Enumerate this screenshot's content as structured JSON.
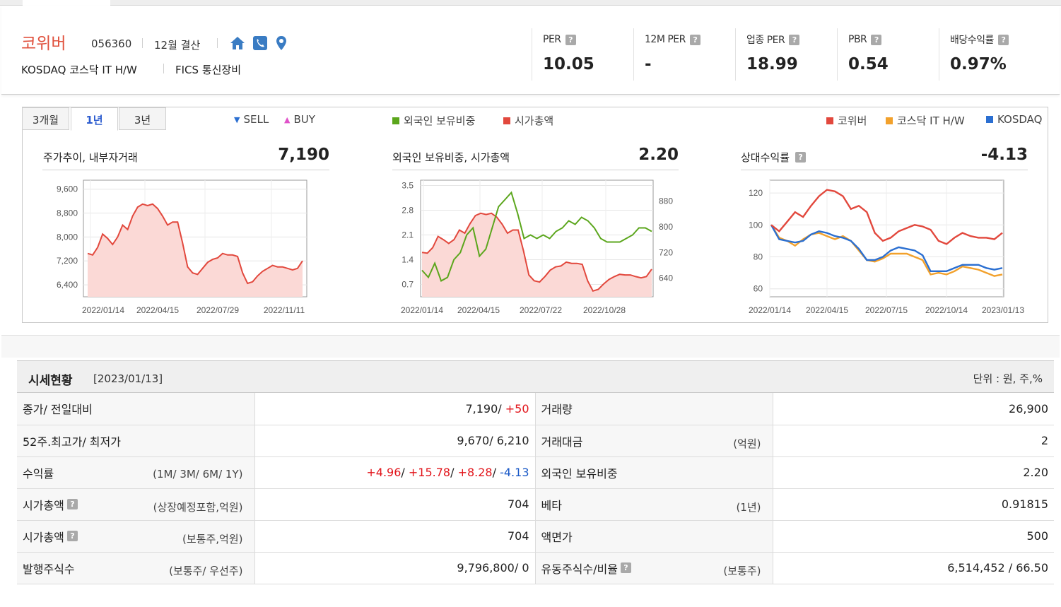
{
  "company": {
    "name": "코위버",
    "code": "056360",
    "settlement": "12월 결산",
    "market": "KOSDAQ  코스닥 IT H/W",
    "fics": "FICS 통신장비",
    "icons": [
      "home-icon",
      "phone-icon",
      "location-pin-icon"
    ]
  },
  "metrics": [
    {
      "label": "PER",
      "value": "10.05"
    },
    {
      "label": "12M PER",
      "value": "-"
    },
    {
      "label": "업종 PER",
      "value": "18.99"
    },
    {
      "label": "PBR",
      "value": "0.54"
    },
    {
      "label": "배당수익률",
      "value": "0.97%"
    }
  ],
  "tabs": [
    {
      "label": "3개월",
      "active": false
    },
    {
      "label": "1년",
      "active": true
    },
    {
      "label": "3년",
      "active": false
    }
  ],
  "legends": {
    "sell": "SELL",
    "buy": "BUY",
    "foreign": "외국인 보유비중",
    "marketcap": "시가총액",
    "company": "코위버",
    "sector": "코스닥 IT H/W",
    "index": "KOSDAQ"
  },
  "colors": {
    "red_line": "#e2483d",
    "red_fill": "#fbd9d6",
    "green_line": "#5ba61c",
    "orange_line": "#f2a12c",
    "blue_line": "#2b6fd1",
    "brand": "#e0513d"
  },
  "panels": {
    "price": {
      "title": "주가추이, 내부자거래",
      "value": "7,190"
    },
    "foreign": {
      "title": "외국인 보유비중, 시가총액",
      "value": "2.20"
    },
    "relative": {
      "title": "상대수익률",
      "value": "-4.13"
    }
  },
  "chart_data": [
    {
      "type": "area",
      "title": "주가추이, 내부자거래",
      "x_labels": [
        "2022/01/14",
        "2022/04/15",
        "2022/07/29",
        "2022/11/11"
      ],
      "y_ticks": [
        "9,600",
        "8,800",
        "8,000",
        "7,200",
        "6,400"
      ],
      "ylim": [
        6000,
        9900
      ],
      "series": [
        {
          "name": "코위버",
          "values": [
            7450,
            7400,
            7650,
            8100,
            7950,
            7750,
            8000,
            8400,
            8250,
            8700,
            9000,
            9100,
            9050,
            9100,
            8950,
            8700,
            8400,
            8500,
            8500,
            7800,
            7000,
            6800,
            6750,
            6950,
            7150,
            7250,
            7300,
            7450,
            7400,
            7400,
            7350,
            6800,
            6450,
            6500,
            6700,
            6850,
            6950,
            7050,
            7000,
            7000,
            6950,
            6900,
            6950,
            7200
          ]
        }
      ]
    },
    {
      "type": "line",
      "title": "외국인 보유비중, 시가총액",
      "x_labels": [
        "2022/01/14",
        "2022/04/15",
        "2022/07/22",
        "2022/10/28"
      ],
      "y_ticks_left": [
        "3.5",
        "2.8",
        "2.1",
        "1.4",
        "0.7"
      ],
      "y_ticks_right": [
        "880",
        "800",
        "720",
        "640"
      ],
      "series": [
        {
          "name": "외국인 보유비중",
          "values": [
            1.1,
            0.9,
            1.3,
            0.8,
            0.9,
            1.4,
            1.6,
            2.1,
            2.3,
            1.5,
            1.7,
            2.3,
            2.9,
            3.1,
            3.3,
            2.7,
            2.0,
            2.1,
            2.0,
            2.1,
            2.0,
            2.2,
            2.3,
            2.5,
            2.4,
            2.6,
            2.5,
            2.3,
            2.0,
            1.9,
            1.9,
            1.9,
            2.0,
            2.1,
            2.3,
            2.3,
            2.2
          ]
        },
        {
          "name": "시가총액",
          "values": [
            720,
            718,
            735,
            770,
            760,
            748,
            760,
            790,
            780,
            810,
            835,
            842,
            838,
            842,
            830,
            808,
            780,
            790,
            790,
            725,
            650,
            632,
            628,
            645,
            665,
            675,
            678,
            690,
            686,
            686,
            683,
            632,
            600,
            605,
            622,
            636,
            645,
            652,
            650,
            650,
            645,
            641,
            645,
            668
          ]
        }
      ]
    },
    {
      "type": "line",
      "title": "상대수익률",
      "x_labels": [
        "2022/01/14",
        "2022/04/15",
        "2022/07/15",
        "2022/10/14",
        "2023/01/13"
      ],
      "y_ticks": [
        "120",
        "100",
        "80",
        "60"
      ],
      "series": [
        {
          "name": "코위버",
          "values": [
            100,
            96,
            102,
            108,
            105,
            112,
            118,
            122,
            121,
            118,
            110,
            112,
            108,
            95,
            90,
            92,
            96,
            98,
            100,
            99,
            97,
            90,
            88,
            92,
            95,
            93,
            92,
            92,
            91,
            95
          ]
        },
        {
          "name": "코스닥 IT H/W",
          "values": [
            100,
            92,
            90,
            87,
            91,
            94,
            95,
            93,
            91,
            93,
            90,
            84,
            78,
            77,
            79,
            82,
            82,
            82,
            80,
            78,
            69,
            70,
            69,
            71,
            74,
            73,
            72,
            70,
            68,
            69
          ]
        },
        {
          "name": "KOSDAQ",
          "values": [
            100,
            91,
            90,
            89,
            90,
            94,
            96,
            95,
            93,
            92,
            90,
            85,
            78,
            78,
            80,
            84,
            86,
            85,
            84,
            81,
            71,
            71,
            71,
            73,
            75,
            75,
            75,
            73,
            72,
            73
          ]
        }
      ]
    }
  ],
  "quote": {
    "title": "시세현황",
    "date": "[2023/01/13]",
    "unit": "단위 : 원, 주,%",
    "rows": [
      {
        "l1": "종가/ 전일대비",
        "s1": "",
        "v1a": "7,190/",
        "v1b": "+50",
        "l2": "거래량",
        "s2": "",
        "v2": "26,900"
      },
      {
        "l1": "52주.최고가/ 최저가",
        "s1": "",
        "v1a": "9,670/ 6,210",
        "l2": "거래대금",
        "s2": "(억원)",
        "v2": "2"
      },
      {
        "l1": "수익률",
        "s1": "(1M/ 3M/ 6M/ 1Y)",
        "l2": "외국인 보유비중",
        "s2": "",
        "v2": "2.20"
      },
      {
        "l1": "시가총액",
        "s1": "(상장예정포함,억원)",
        "v1a": "704",
        "l2": "베타",
        "s2": "(1년)",
        "v2": "0.91815"
      },
      {
        "l1": "시가총액",
        "s1": "(보통주,억원)",
        "v1a": "704",
        "l2": "액면가",
        "s2": "",
        "v2": "500"
      },
      {
        "l1": "발행주식수",
        "s1": "(보통주/ 우선주)",
        "v1a": "9,796,800/ 0",
        "l2": "유동주식수/비율",
        "s2": "(보통주)",
        "v2": "6,514,452 / 66.50"
      }
    ],
    "returns": {
      "m1": "+4.96",
      "m3": "+15.78",
      "m6": "+8.28",
      "y1": "-4.13"
    }
  }
}
